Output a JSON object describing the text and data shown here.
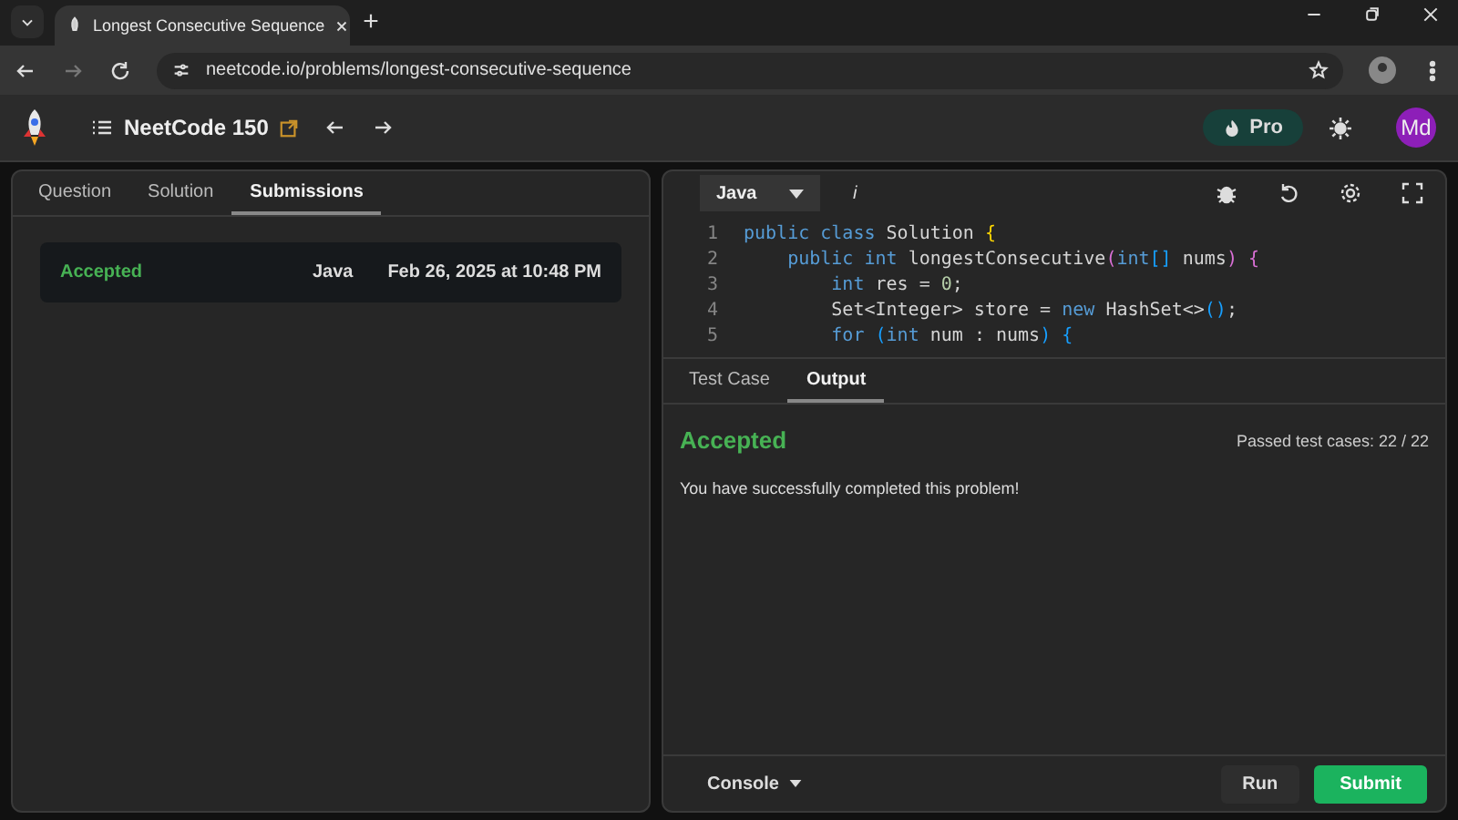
{
  "browser": {
    "tab_title": "Longest Consecutive Sequence",
    "url": "neetcode.io/problems/longest-consecutive-sequence"
  },
  "header": {
    "list_title": "NeetCode 150",
    "pro_label": "Pro",
    "avatar": "Md"
  },
  "left_panel": {
    "tabs": [
      {
        "label": "Question",
        "selected": false
      },
      {
        "label": "Solution",
        "selected": false
      },
      {
        "label": "Submissions",
        "selected": true
      }
    ],
    "submissions": [
      {
        "status": "Accepted",
        "language": "Java",
        "date": "Feb 26, 2025 at 10:48 PM"
      }
    ]
  },
  "editor": {
    "language": "Java",
    "info": "i",
    "lines": [
      {
        "number": "1",
        "tokens": [
          {
            "kind": "kw",
            "text": "public class"
          },
          {
            "kind": "plain",
            "text": " Solution "
          },
          {
            "kind": "b1",
            "text": "{"
          }
        ]
      },
      {
        "number": "2",
        "tokens": [
          {
            "kind": "kw",
            "text": "    public int"
          },
          {
            "kind": "plain",
            "text": " longestConsecutive"
          },
          {
            "kind": "b2",
            "text": "("
          },
          {
            "kind": "kw",
            "text": "int"
          },
          {
            "kind": "b3",
            "text": "[]"
          },
          {
            "kind": "plain",
            "text": " nums"
          },
          {
            "kind": "b2",
            "text": ") {"
          }
        ]
      },
      {
        "number": "3",
        "tokens": [
          {
            "kind": "kw",
            "text": "        int"
          },
          {
            "kind": "plain",
            "text": " res = "
          },
          {
            "kind": "num",
            "text": "0"
          },
          {
            "kind": "plain",
            "text": ";"
          }
        ]
      },
      {
        "number": "4",
        "tokens": [
          {
            "kind": "plain",
            "text": "        Set<Integer> store = "
          },
          {
            "kind": "kw",
            "text": "new"
          },
          {
            "kind": "plain",
            "text": " HashSet<>"
          },
          {
            "kind": "b3",
            "text": "()"
          },
          {
            "kind": "plain",
            "text": ";"
          }
        ]
      },
      {
        "number": "5",
        "tokens": [
          {
            "kind": "kw",
            "text": "        for"
          },
          {
            "kind": "b3",
            "text": " ("
          },
          {
            "kind": "kw",
            "text": "int"
          },
          {
            "kind": "plain",
            "text": " num : nums"
          },
          {
            "kind": "b3",
            "text": ") {"
          }
        ]
      }
    ]
  },
  "result": {
    "tabs": [
      {
        "label": "Test Case",
        "selected": false
      },
      {
        "label": "Output",
        "selected": true
      }
    ],
    "status": "Accepted",
    "passed": "Passed test cases: 22 / 22",
    "message": "You have successfully completed this problem!"
  },
  "footer": {
    "console": "Console",
    "run": "Run",
    "submit": "Submit"
  }
}
